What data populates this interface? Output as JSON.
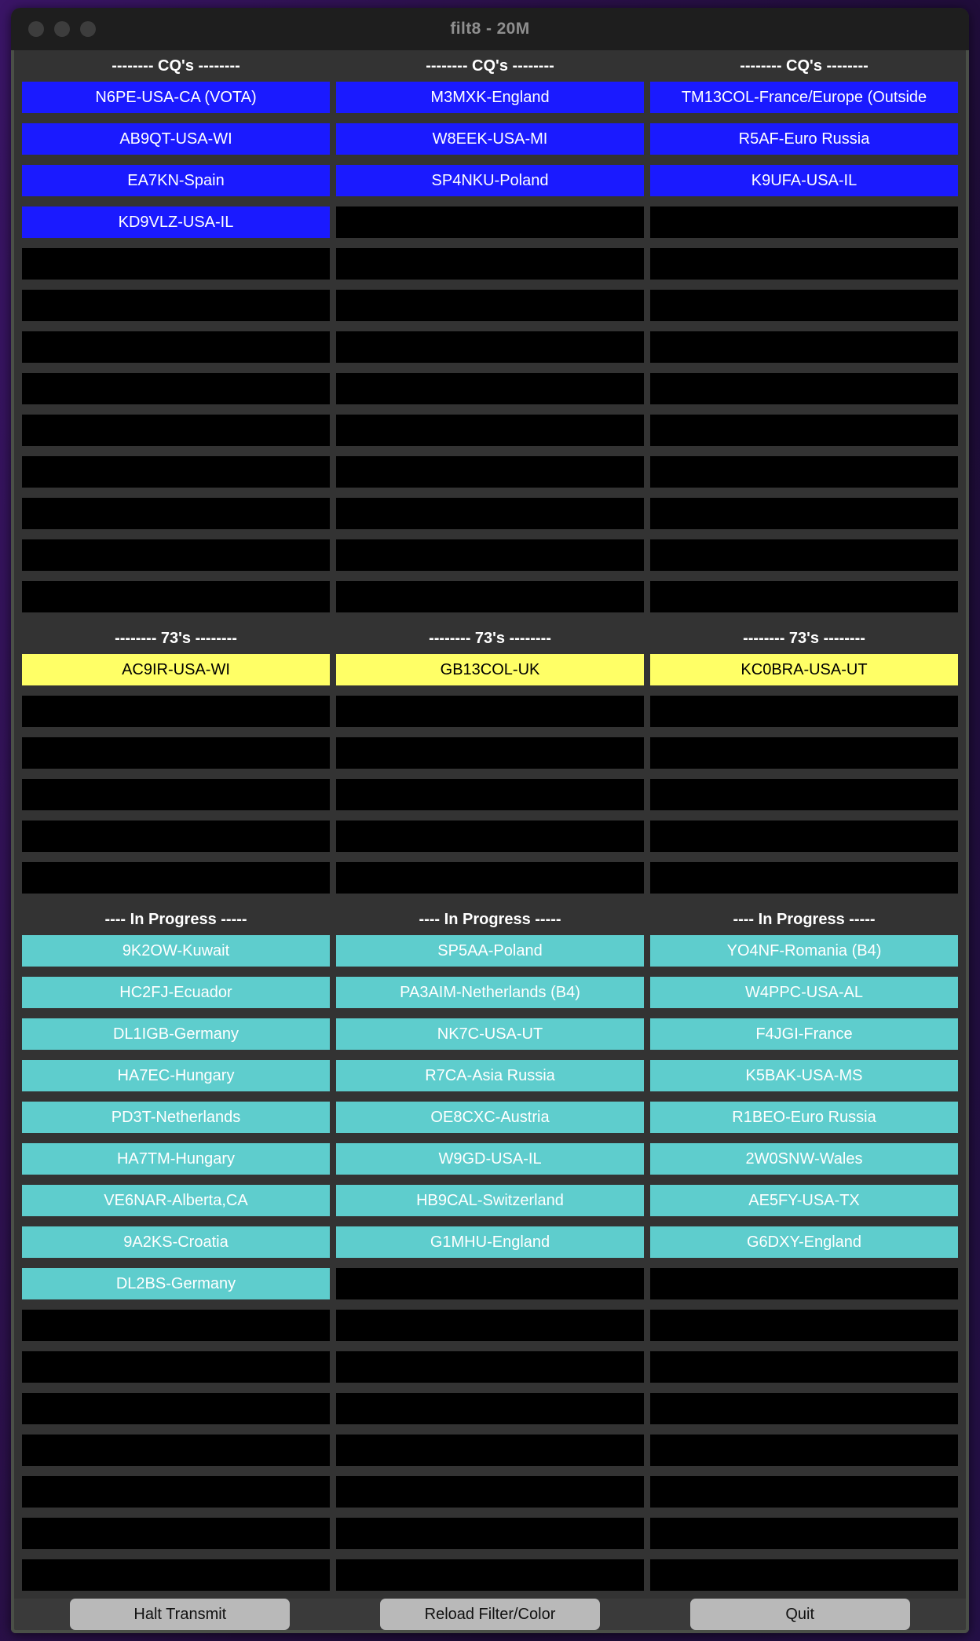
{
  "window": {
    "title": "filt8 - 20M",
    "traffic_lights": [
      "close-button",
      "minimize-button",
      "zoom-button"
    ]
  },
  "sections": [
    {
      "id": "cq",
      "header": "-------- CQ's --------",
      "headers": [
        "-------- CQ's --------",
        "-------- CQ's --------",
        "-------- CQ's --------"
      ],
      "color": "#1a1aff",
      "text_color": "#ffffff",
      "total_rows": 13,
      "columns": [
        [
          "N6PE-USA-CA (VOTA)",
          "AB9QT-USA-WI",
          "EA7KN-Spain",
          "KD9VLZ-USA-IL"
        ],
        [
          "M3MXK-England",
          "W8EEK-USA-MI",
          "SP4NKU-Poland"
        ],
        [
          "TM13COL-France/Europe (Outside",
          "R5AF-Euro Russia",
          "K9UFA-USA-IL"
        ]
      ]
    },
    {
      "id": "seventy_threes",
      "header": "-------- 73's --------",
      "headers": [
        "-------- 73's --------",
        "-------- 73's --------",
        "-------- 73's --------"
      ],
      "color": "#ffff66",
      "text_color": "#000000",
      "total_rows": 6,
      "columns": [
        [
          "AC9IR-USA-WI"
        ],
        [
          "GB13COL-UK"
        ],
        [
          "KC0BRA-USA-UT"
        ]
      ]
    },
    {
      "id": "in_progress",
      "header": "---- In Progress -----",
      "headers": [
        "---- In Progress -----",
        "---- In Progress -----",
        "---- In Progress -----"
      ],
      "color": "#5ecdcd",
      "text_color": "#ffffff",
      "total_rows": 17,
      "columns": [
        [
          "9K2OW-Kuwait",
          "HC2FJ-Ecuador",
          "DL1IGB-Germany",
          "HA7EC-Hungary",
          "PD3T-Netherlands",
          "HA7TM-Hungary",
          "VE6NAR-Alberta,CA",
          "9A2KS-Croatia",
          "DL2BS-Germany"
        ],
        [
          "SP5AA-Poland",
          "PA3AIM-Netherlands (B4)",
          "NK7C-USA-UT",
          "R7CA-Asia Russia",
          "OE8CXC-Austria",
          "W9GD-USA-IL",
          "HB9CAL-Switzerland",
          "G1MHU-England"
        ],
        [
          "YO4NF-Romania (B4)",
          "W4PPC-USA-AL",
          "F4JGI-France",
          "K5BAK-USA-MS",
          "R1BEO-Euro Russia",
          "2W0SNW-Wales",
          "AE5FY-USA-TX",
          "G6DXY-England"
        ]
      ]
    }
  ],
  "footer": {
    "buttons": [
      {
        "name": "halt-transmit-button",
        "label": "Halt Transmit"
      },
      {
        "name": "reload-filter-color-button",
        "label": "Reload Filter/Color"
      },
      {
        "name": "quit-button",
        "label": "Quit"
      }
    ]
  }
}
